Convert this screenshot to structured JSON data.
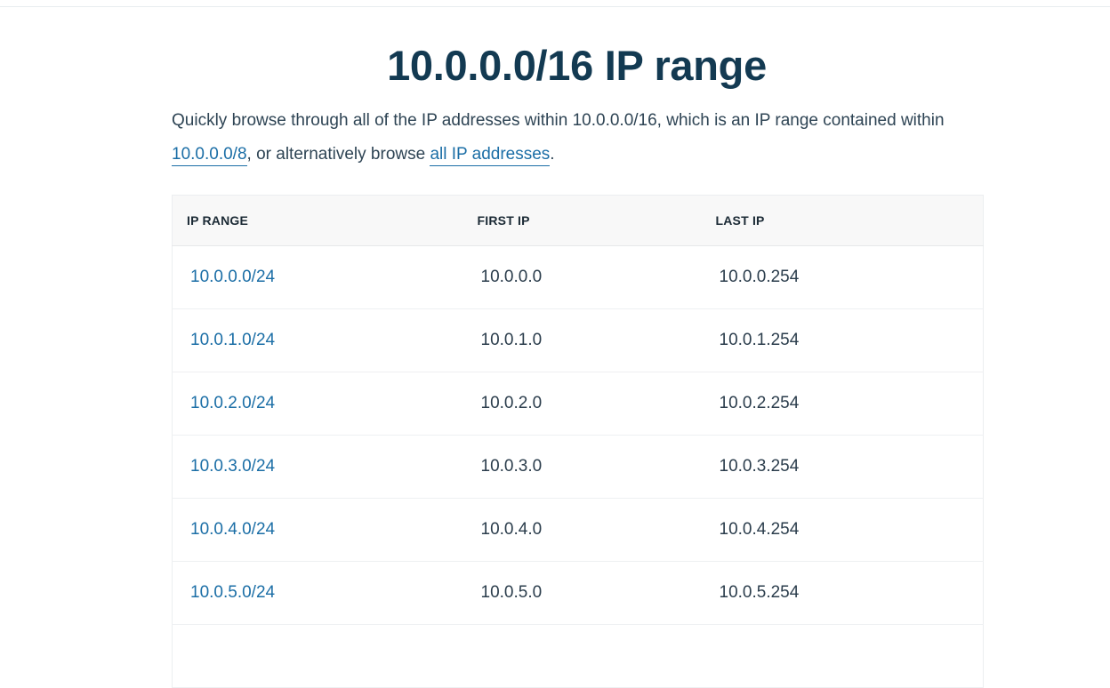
{
  "page": {
    "title": "10.0.0.0/16 IP range",
    "intro": {
      "text_before": "Quickly browse through all of the IP addresses within 10.0.0.0/16, which is an IP range contained within ",
      "parent_link": "10.0.0.0/8",
      "text_middle": ", or alternatively browse ",
      "all_link": "all IP addresses",
      "text_after": "."
    }
  },
  "table": {
    "headers": {
      "range": "IP RANGE",
      "first": "FIRST IP",
      "last": "LAST IP"
    },
    "rows": [
      {
        "range": "10.0.0.0/24",
        "first": "10.0.0.0",
        "last": "10.0.0.254"
      },
      {
        "range": "10.0.1.0/24",
        "first": "10.0.1.0",
        "last": "10.0.1.254"
      },
      {
        "range": "10.0.2.0/24",
        "first": "10.0.2.0",
        "last": "10.0.2.254"
      },
      {
        "range": "10.0.3.0/24",
        "first": "10.0.3.0",
        "last": "10.0.3.254"
      },
      {
        "range": "10.0.4.0/24",
        "first": "10.0.4.0",
        "last": "10.0.4.254"
      },
      {
        "range": "10.0.5.0/24",
        "first": "10.0.5.0",
        "last": "10.0.5.254"
      }
    ]
  },
  "colors": {
    "title": "#133a52",
    "link": "#1b6ea6",
    "text": "#2e4454",
    "header_bg": "#f8f8f8"
  }
}
